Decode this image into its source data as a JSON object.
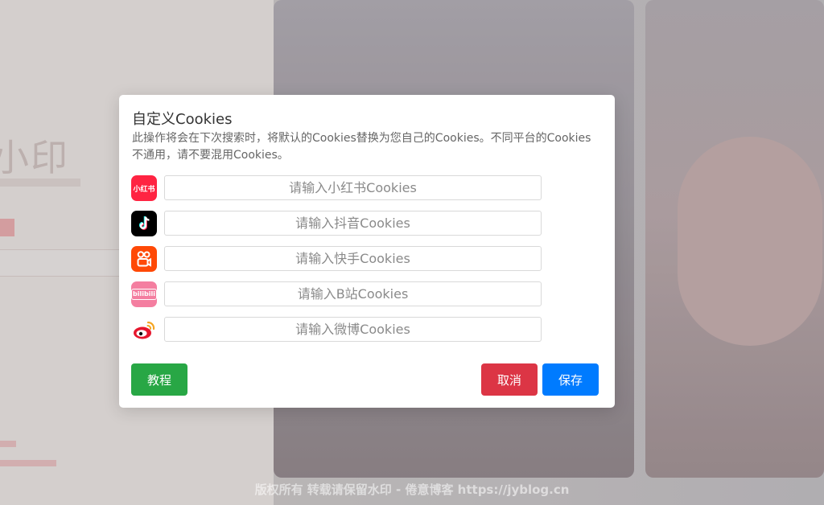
{
  "modal": {
    "title": "自定义Cookies",
    "description": "此操作将会在下次搜索时，将默认的Cookies替换为您自己的Cookies。不同平台的Cookies不通用，请不要混用Cookies。",
    "fields": [
      {
        "icon": "xiaohongshu-icon",
        "icon_text": "小红书",
        "placeholder": "请输入小红书Cookies",
        "value": "",
        "color": "#ff2442"
      },
      {
        "icon": "douyin-icon",
        "icon_text": "♪",
        "placeholder": "请输入抖音Cookies",
        "value": "",
        "color": "#000000"
      },
      {
        "icon": "kuaishou-icon",
        "icon_text": "",
        "placeholder": "请输入快手Cookies",
        "value": "",
        "color": "#ff4906"
      },
      {
        "icon": "bilibili-icon",
        "icon_text": "bilibili",
        "placeholder": "请输入B站Cookies",
        "value": "",
        "color": "#f47ea0"
      },
      {
        "icon": "weibo-icon",
        "icon_text": "",
        "placeholder": "请输入微博Cookies",
        "value": "",
        "color": "#e6162d"
      }
    ],
    "buttons": {
      "tutorial": "教程",
      "cancel": "取消",
      "save": "保存"
    }
  },
  "background": {
    "watermark": "版权所有 转载请保留水印 - 倦意博客 https://jyblog.cn"
  },
  "colors": {
    "tutorial": "#28a745",
    "cancel": "#dc3545",
    "save": "#007bff"
  }
}
